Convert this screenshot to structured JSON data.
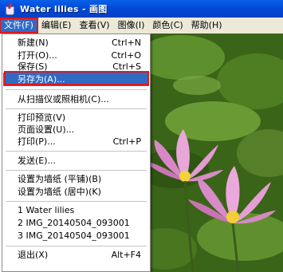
{
  "window": {
    "title": "Water lilies - 画图"
  },
  "menubar": {
    "items": [
      {
        "label": "文件(F)"
      },
      {
        "label": "编辑(E)"
      },
      {
        "label": "查看(V)"
      },
      {
        "label": "图像(I)"
      },
      {
        "label": "颜色(C)"
      },
      {
        "label": "帮助(H)"
      }
    ]
  },
  "file_menu": {
    "items": [
      {
        "label": "新建(N)",
        "shortcut": "Ctrl+N"
      },
      {
        "label": "打开(O)...",
        "shortcut": "Ctrl+O"
      },
      {
        "label": "保存(S)",
        "shortcut": "Ctrl+S"
      },
      {
        "label": "另存为(A)...",
        "shortcut": ""
      },
      {
        "label": "从扫描仪或照相机(C)...",
        "shortcut": ""
      },
      {
        "label": "打印预览(V)",
        "shortcut": ""
      },
      {
        "label": "页面设置(U)...",
        "shortcut": ""
      },
      {
        "label": "打印(P)...",
        "shortcut": "Ctrl+P"
      },
      {
        "label": "发送(E)...",
        "shortcut": ""
      },
      {
        "label": "设置为墙纸 (平铺)(B)",
        "shortcut": ""
      },
      {
        "label": "设置为墙纸 (居中)(K)",
        "shortcut": ""
      },
      {
        "label": "1 Water lilies",
        "shortcut": ""
      },
      {
        "label": "2 IMG_20140504_093001",
        "shortcut": ""
      },
      {
        "label": "3 IMG_20140504_093001",
        "shortcut": ""
      },
      {
        "label": "退出(X)",
        "shortcut": "Alt+F4"
      }
    ]
  },
  "colors": {
    "highlight": "#316ac5",
    "annotation_box": "#e01818",
    "titlebar": "#0a5fe8"
  }
}
